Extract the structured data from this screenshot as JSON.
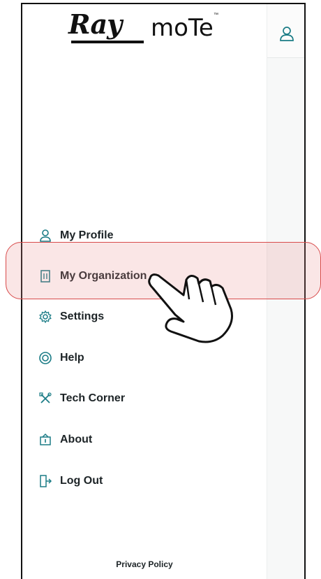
{
  "logo": {
    "brand_primary": "Ray",
    "brand_secondary": "moTe",
    "trademark": "™"
  },
  "header": {
    "profile_icon": "user-icon"
  },
  "menu": {
    "items": [
      {
        "label": "My Profile",
        "icon": "user-icon"
      },
      {
        "label": "My Organization",
        "icon": "building-icon"
      },
      {
        "label": "Settings",
        "icon": "gear-icon"
      },
      {
        "label": "Help",
        "icon": "lifebuoy-icon"
      },
      {
        "label": "Tech Corner",
        "icon": "tools-icon"
      },
      {
        "label": "About",
        "icon": "info-icon"
      },
      {
        "label": "Log Out",
        "icon": "logout-icon"
      }
    ]
  },
  "footer": {
    "privacy_label": "Privacy Policy"
  },
  "colors": {
    "highlight": "#d84a4a",
    "teal_icon": "#1b7c86",
    "text": "#1c2326"
  }
}
